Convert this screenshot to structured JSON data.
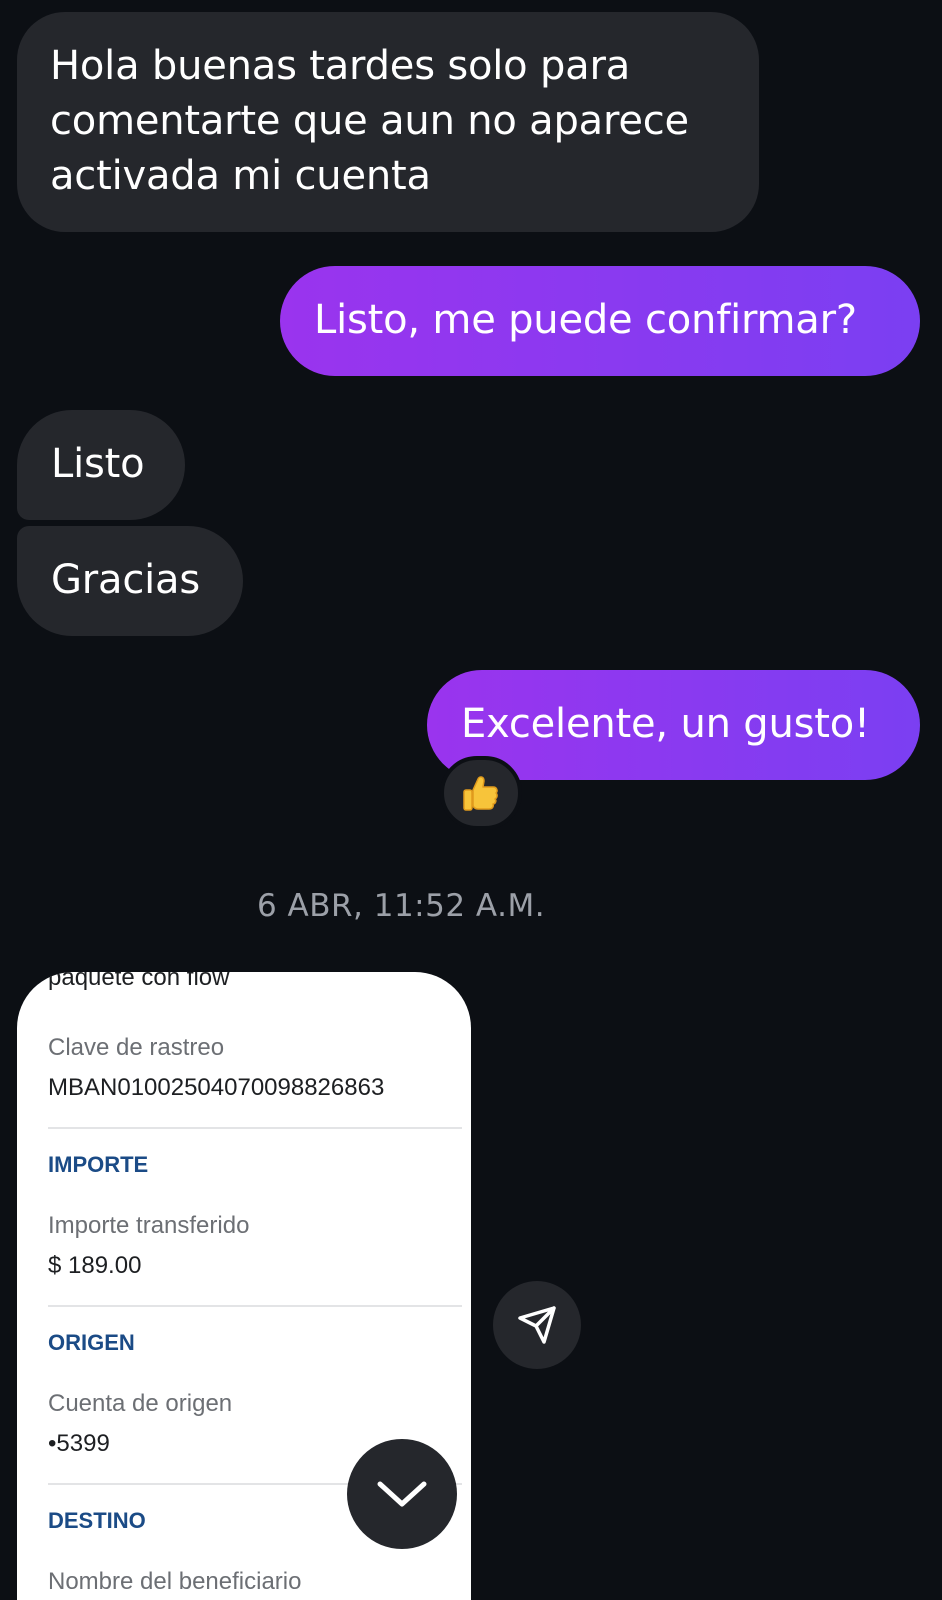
{
  "conversation": {
    "messages": [
      {
        "direction": "incoming",
        "text": "Hola buenas tardes solo para comentarte que aun no aparece activada mi cuenta"
      },
      {
        "direction": "outgoing",
        "text": "Listo, me puede confirmar?"
      },
      {
        "direction": "incoming",
        "text": "Listo"
      },
      {
        "direction": "incoming",
        "text": "Gracias"
      },
      {
        "direction": "outgoing",
        "text": "Excelente, un gusto!",
        "reaction": "👍"
      }
    ],
    "timestamp": "6 ABR, 11:52 A.M."
  },
  "receipt": {
    "concept_tail": "paquete con flow",
    "clave_label": "Clave de rastreo",
    "clave_value": "MBAN01002504070098826863",
    "importe_header": "IMPORTE",
    "importe_label": "Importe transferido",
    "importe_value": "$ 189.00",
    "origen_header": "ORIGEN",
    "origen_label": "Cuenta de origen",
    "origen_value": "•5399",
    "destino_header": "DESTINO",
    "destino_label": "Nombre del beneficiario"
  },
  "icons": {
    "share": "paper-plane-icon",
    "scroll_down": "chevron-down-icon"
  },
  "colors": {
    "background": "#0c0f14",
    "incoming_bubble": "#25272c",
    "outgoing_start": "#9a34ee",
    "outgoing_end": "#7b3ff2",
    "receipt_header": "#1b4b86"
  }
}
